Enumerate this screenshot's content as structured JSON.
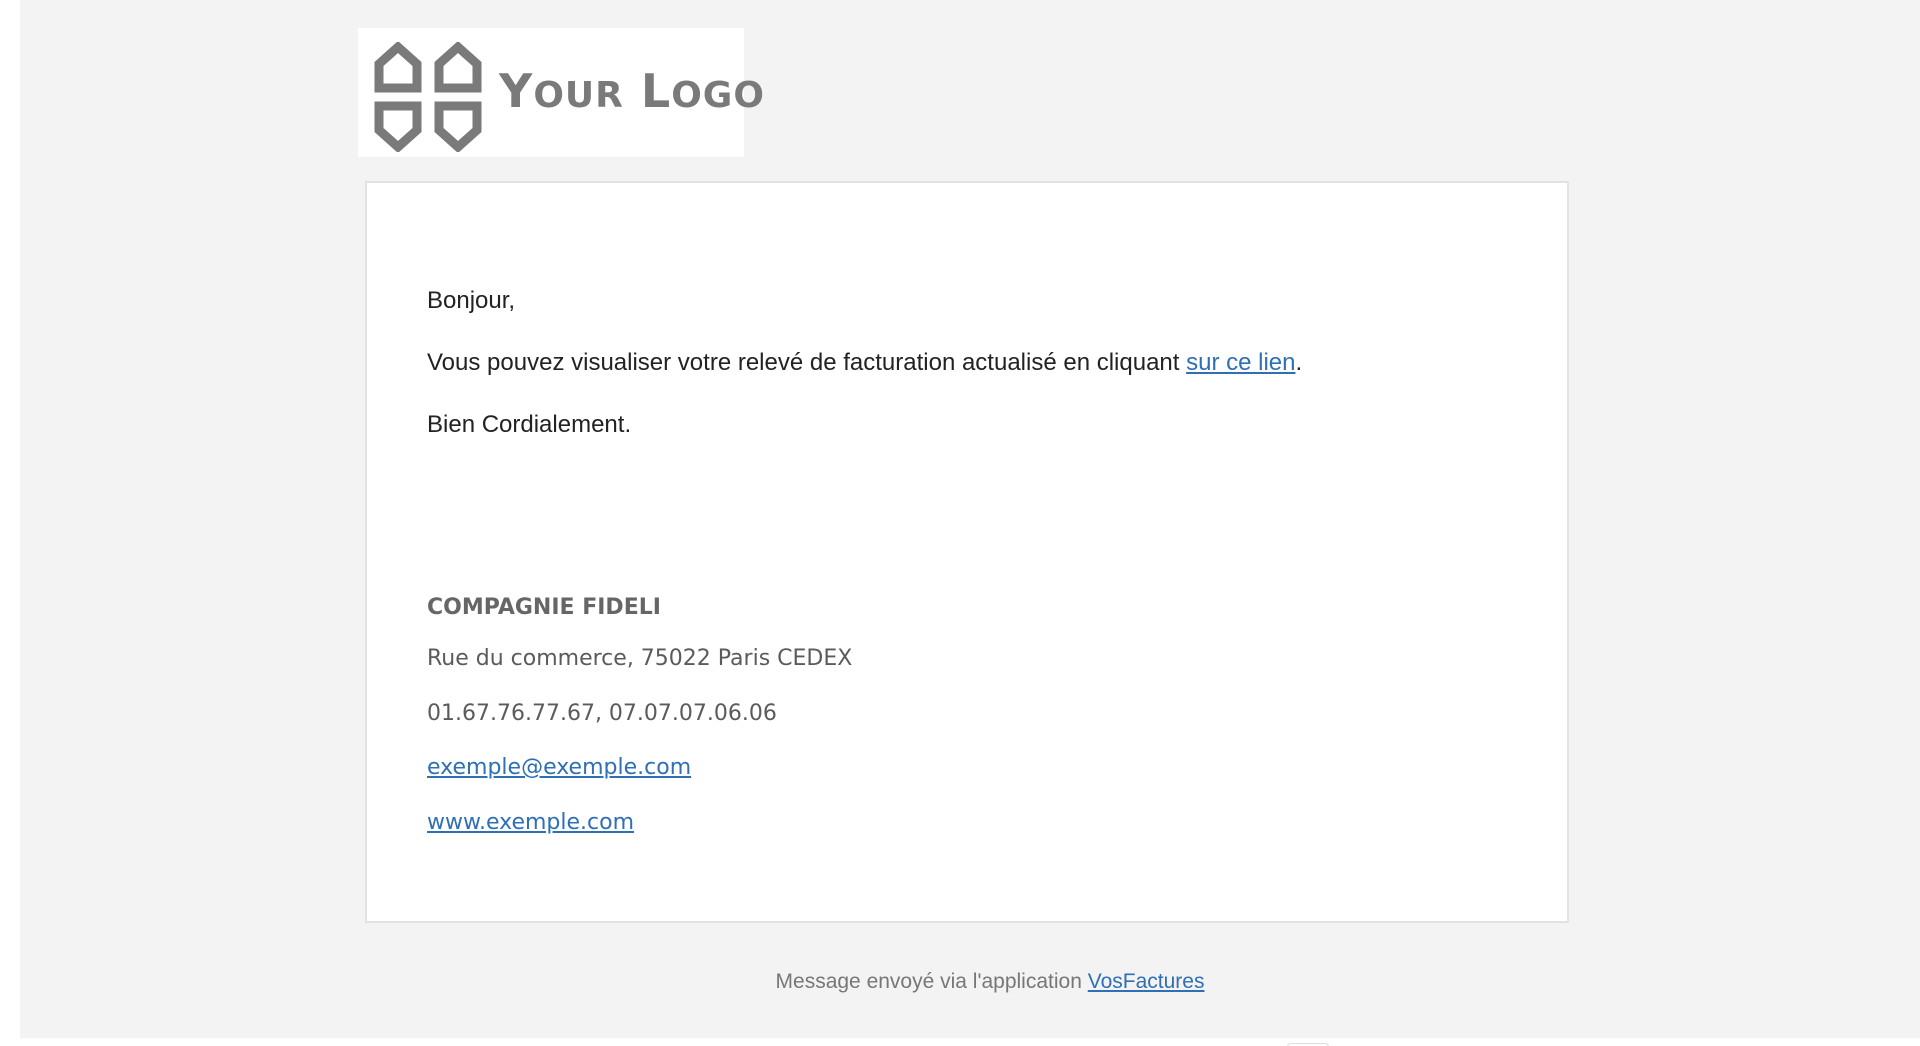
{
  "header": {
    "logo": {
      "text_first": "Y",
      "text_first_rest": "OUR",
      "text_second": "L",
      "text_second_rest": "OGO",
      "color": "#7a7a7a"
    }
  },
  "message": {
    "greeting": "Bonjour,",
    "body_text": "Vous pouvez visualiser votre relevé de facturation actualisé en cliquant ",
    "body_link": "sur ce lien",
    "body_end": ".",
    "closing": "Bien Cordialement."
  },
  "signature": {
    "company": "COMPAGNIE FIDELI",
    "address": "Rue du commerce, 75022 Paris CEDEX",
    "phones": "01.67.76.77.67, 07.07.07.06.06",
    "email": "exemple@exemple.com",
    "website": "www.exemple.com"
  },
  "footer": {
    "text": "Message envoyé via l'application ",
    "link": "VosFactures"
  },
  "colors": {
    "link": "#2f6fb5",
    "background": "#f3f3f3",
    "card": "#ffffff",
    "text": "#222222",
    "muted": "#777777"
  }
}
